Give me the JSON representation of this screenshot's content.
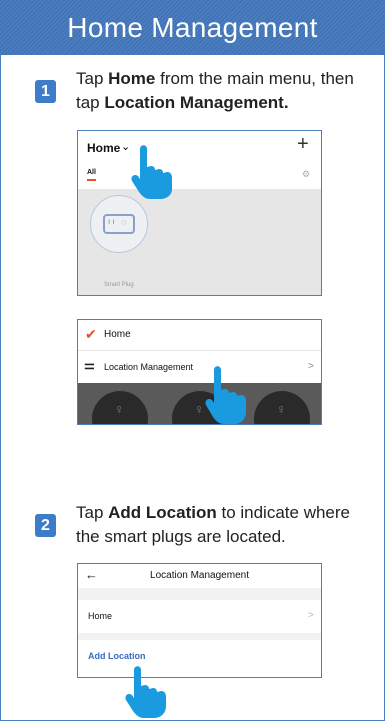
{
  "title": "Home Management",
  "step1": {
    "number": "1",
    "text_a": "Tap ",
    "bold_a": "Home",
    "text_b": " from the main menu, then tap ",
    "bold_b": "Location Management."
  },
  "screen1": {
    "home_label": "Home",
    "plus": "+",
    "tab_all": "All",
    "device_label": "Smart Plug"
  },
  "screen2": {
    "home_label": "Home",
    "location_label": "Location Management",
    "chevron": ">"
  },
  "step2": {
    "number": "2",
    "text_a": "Tap ",
    "bold_a": "Add Location",
    "text_b": " to indicate where the smart plugs are located."
  },
  "screen3": {
    "back": "←",
    "title": "Location Management",
    "home_label": "Home",
    "chevron": ">",
    "add_label": "Add Location"
  },
  "colors": {
    "accent": "#3c7cc8",
    "title_bar": "#4a7dc0",
    "check": "#e8502c",
    "hand": "#1a9be0"
  }
}
